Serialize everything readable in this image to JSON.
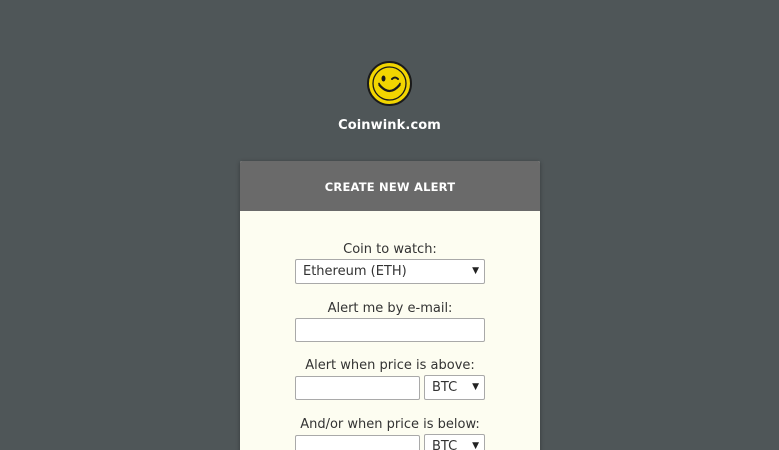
{
  "brand": {
    "name": "Coinwink.com",
    "logo_icon": "winking-smiley-icon",
    "logo_color": "#f2d500"
  },
  "form": {
    "title": "CREATE NEW ALERT",
    "coin_label": "Coin to watch:",
    "coin_selected": "Ethereum (ETH)",
    "email_label": "Alert me by e-mail:",
    "email_value": "",
    "above_label": "Alert when price is above:",
    "above_value": "",
    "above_currency": "BTC",
    "below_label": "And/or when price is below:",
    "below_value": "",
    "below_currency": "BTC"
  },
  "colors": {
    "background": "#4f5658",
    "card_header": "#6a6a6a",
    "card_body": "#fdfdf1"
  }
}
